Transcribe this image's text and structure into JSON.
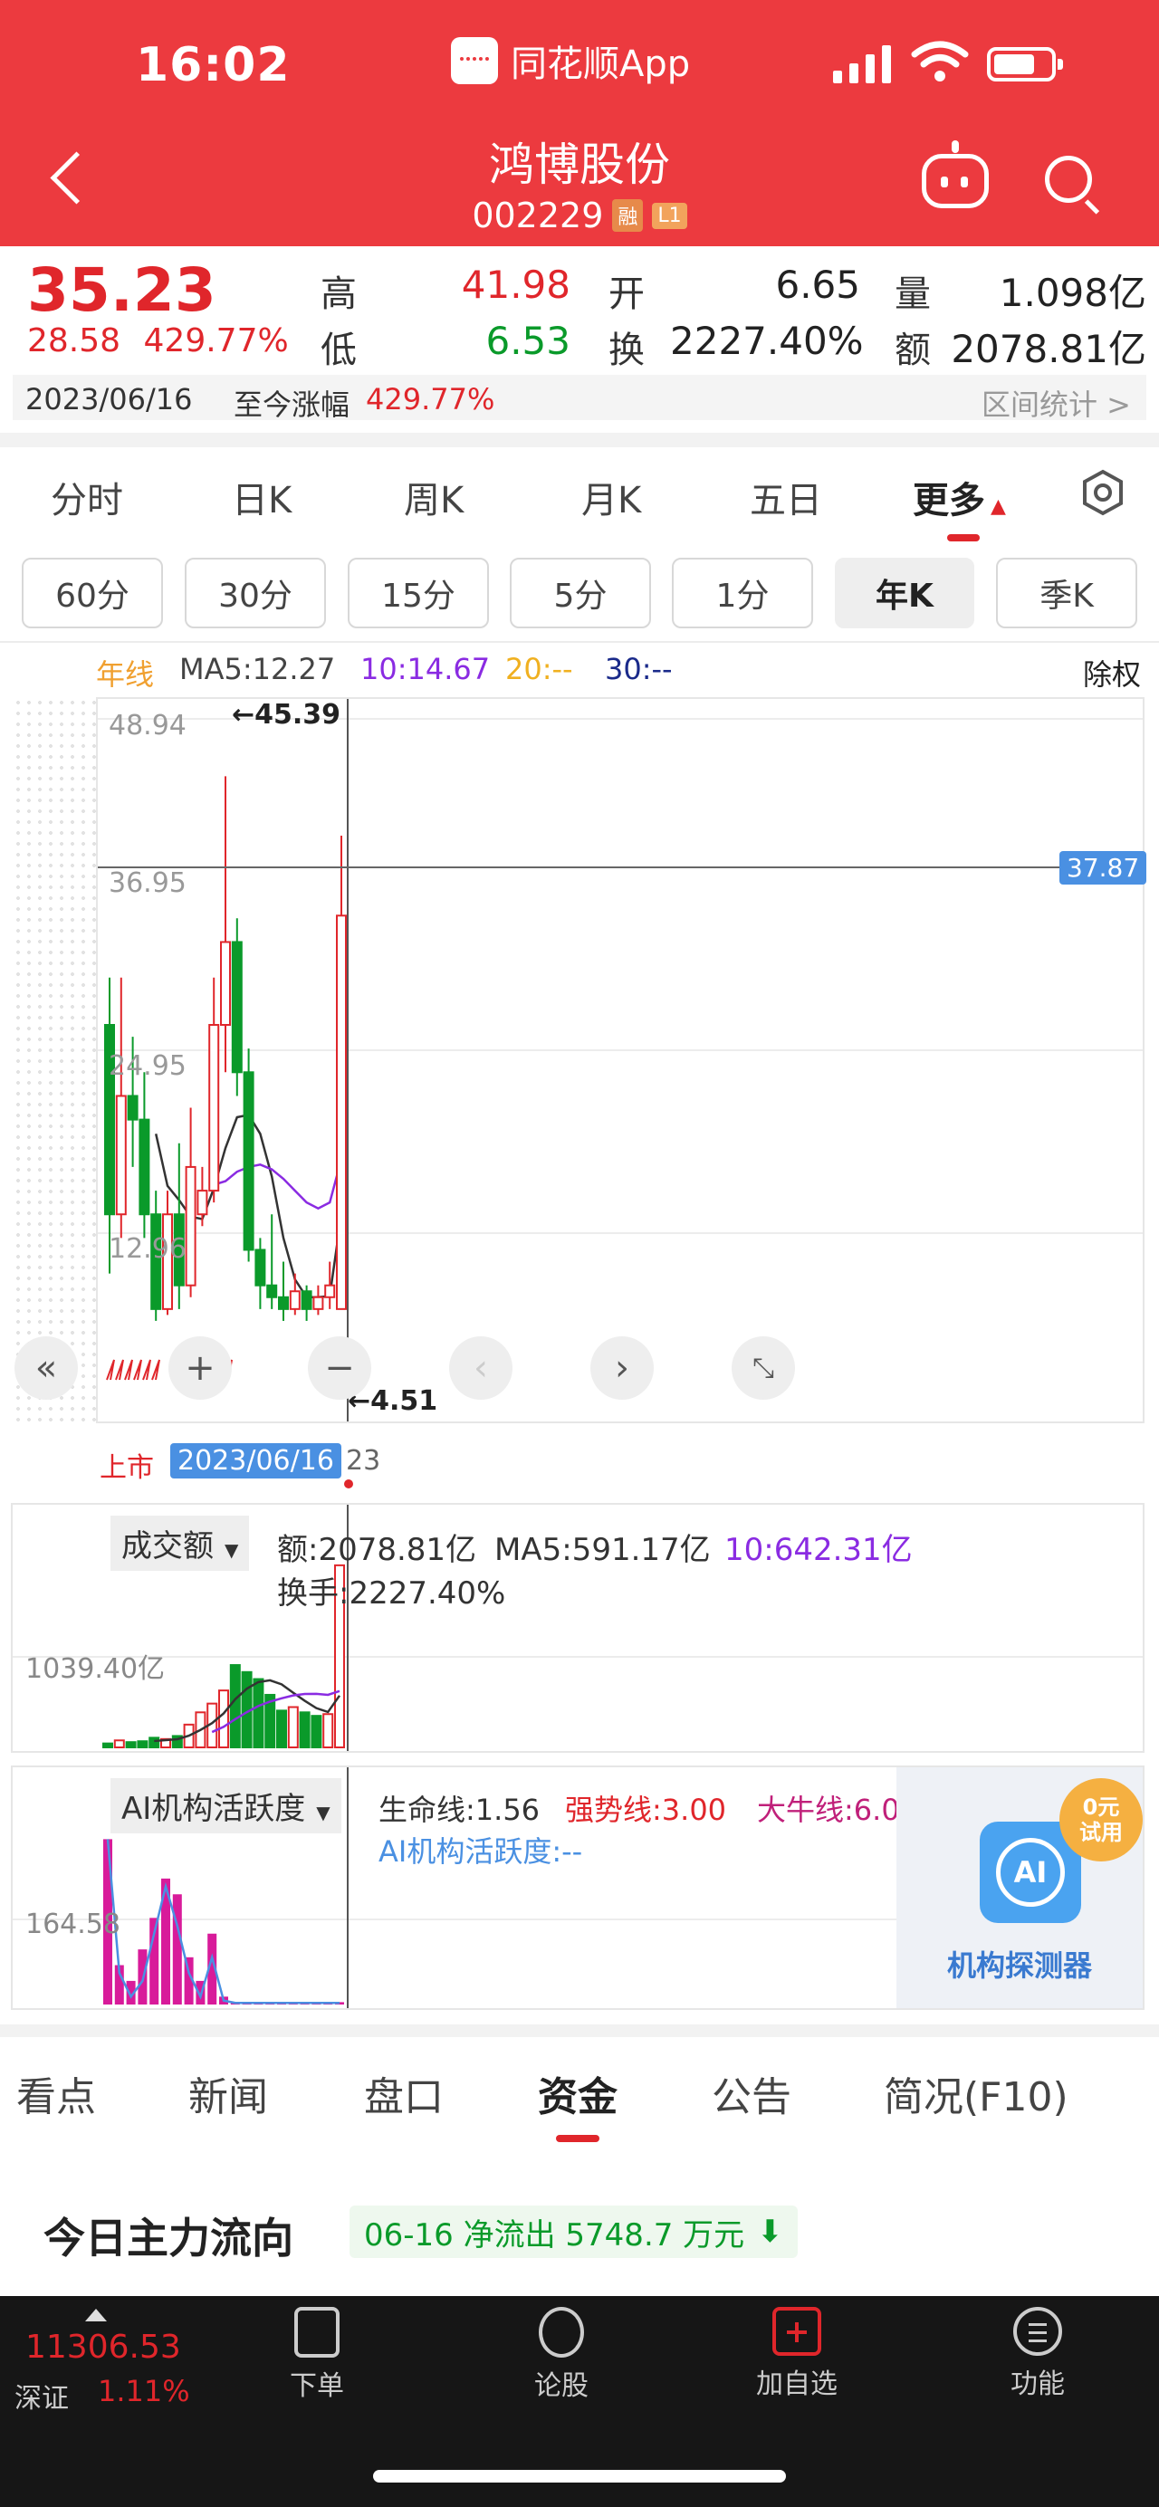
{
  "status_bar": {
    "time": "16:02",
    "app_name": "同花顺App"
  },
  "header": {
    "title": "鸿博股份",
    "code": "002229",
    "badge_rong": "融",
    "badge_level": "L1"
  },
  "quote": {
    "price": "35.23",
    "change": "28.58",
    "change_pct": "429.77%",
    "high_label": "高",
    "high": "41.98",
    "low_label": "低",
    "low": "6.53",
    "open_label": "开",
    "open": "6.65",
    "turnover_label": "换",
    "turnover": "2227.40%",
    "volume_label": "量",
    "volume": "1.098亿",
    "amount_label": "额",
    "amount": "2078.81亿",
    "date": "2023/06/16",
    "since_label": "至今涨幅",
    "since_pct": "429.77%",
    "interval_stats": "区间统计 >"
  },
  "period_tabs": [
    "分时",
    "日K",
    "周K",
    "月K",
    "五日",
    "更多"
  ],
  "sub_tabs": [
    "60分",
    "30分",
    "15分",
    "5分",
    "1分",
    "年K",
    "季K"
  ],
  "ma_line": {
    "name": "年线",
    "ma5": "MA5:12.27",
    "ma10": "10:14.67",
    "ma20": "20:--",
    "ma30": "30:--",
    "adjust": "除权"
  },
  "main_chart": {
    "y_labels": [
      "48.94",
      "36.95",
      "24.95",
      "12.96"
    ],
    "high_mark": "←45.39",
    "low_mark": "←4.51",
    "crosshair_value": "37.87",
    "list_label": "上市",
    "cursor_date": "2023/06/16",
    "cursor_date_suffix": "23"
  },
  "volume_panel": {
    "selector": "成交额",
    "amount": "额:2078.81亿",
    "ma5": "MA5:591.17亿",
    "ma10": "10:642.31亿",
    "turnover": "换手:2227.40%",
    "y_label": "1039.40亿"
  },
  "ai_panel": {
    "selector": "AI机构活跃度",
    "life_line": "生命线:1.56",
    "strong_line": "强势线:3.00",
    "bull_line": "大牛线:6.00",
    "activity": "AI机构活跃度:--",
    "y_label": "164.58",
    "promo_badge_1": "0元",
    "promo_badge_2": "试用",
    "promo_icon": "AI",
    "promo_title": "机构探测器"
  },
  "bottom_tabs": [
    "看点",
    "新闻",
    "盘口",
    "资金",
    "公告",
    "简况(F10)"
  ],
  "flow": {
    "title": "今日主力流向",
    "summary": "06-16 净流出 5748.7 万元"
  },
  "bottom_bar": {
    "index_value": "11306.53",
    "index_name": "深证",
    "index_pct": "1.11%",
    "items": [
      "下单",
      "论股",
      "加自选",
      "功能"
    ]
  },
  "colors": {
    "brand_red": "#ec3a3f",
    "up_red": "#e0262b",
    "down_green": "#0a9a2a",
    "accent_blue": "#4a90e2",
    "purple": "#8a2be2"
  },
  "chart_data": [
    {
      "type": "candlestick",
      "ylim": [
        0,
        52
      ],
      "bars": [
        {
          "o": 26.0,
          "c": 10.0,
          "h": 30.0,
          "l": 5.0
        },
        {
          "o": 10.0,
          "c": 20.0,
          "h": 30.0,
          "l": 8.0
        },
        {
          "o": 20.0,
          "c": 18.0,
          "h": 25.0,
          "l": 14.0
        },
        {
          "o": 18.0,
          "c": 10.0,
          "h": 22.0,
          "l": 8.0
        },
        {
          "o": 10.0,
          "c": 2.0,
          "h": 12.0,
          "l": 1.0
        },
        {
          "o": 2.0,
          "c": 10.0,
          "h": 12.0,
          "l": 1.5
        },
        {
          "o": 10.0,
          "c": 4.0,
          "h": 16.0,
          "l": 2.0
        },
        {
          "o": 4.0,
          "c": 14.0,
          "h": 19.0,
          "l": 3.0
        },
        {
          "o": 10.0,
          "c": 12.0,
          "h": 14.0,
          "l": 9.0
        },
        {
          "o": 12.0,
          "c": 26.0,
          "h": 30.0,
          "l": 11.0
        },
        {
          "o": 26.0,
          "c": 33.0,
          "h": 47.0,
          "l": 22.0
        },
        {
          "o": 33.0,
          "c": 22.0,
          "h": 35.0,
          "l": 20.0
        },
        {
          "o": 22.0,
          "c": 7.0,
          "h": 24.0,
          "l": 6.0
        },
        {
          "o": 7.0,
          "c": 4.0,
          "h": 8.0,
          "l": 2.0
        },
        {
          "o": 4.0,
          "c": 3.0,
          "h": 10.0,
          "l": 2.0
        },
        {
          "o": 3.0,
          "c": 2.0,
          "h": 6.0,
          "l": 1.0
        },
        {
          "o": 2.0,
          "c": 3.5,
          "h": 5.0,
          "l": 1.5
        },
        {
          "o": 3.5,
          "c": 2.0,
          "h": 4.0,
          "l": 1.0
        },
        {
          "o": 2.0,
          "c": 3.0,
          "h": 4.0,
          "l": 1.5
        },
        {
          "o": 3.0,
          "c": 4.0,
          "h": 6.0,
          "l": 2.0
        },
        {
          "o": 2.0,
          "c": 35.23,
          "h": 41.98,
          "l": 4.51
        }
      ],
      "ma5": [
        null,
        null,
        null,
        null,
        16.8,
        12.4,
        11.2,
        9.8,
        9.6,
        12.2,
        15.6,
        18.2,
        18.4,
        16.8,
        13.2,
        8.0,
        4.5,
        3.0,
        3.0,
        3.1,
        10.0
      ],
      "ma10": [
        null,
        null,
        null,
        null,
        null,
        null,
        null,
        null,
        null,
        12.5,
        12.8,
        13.6,
        14.0,
        14.2,
        13.8,
        13.0,
        12.0,
        11.0,
        10.5,
        11.0,
        14.67
      ]
    },
    {
      "type": "bar",
      "ylim": [
        0,
        2150
      ],
      "values": [
        45,
        80,
        60,
        70,
        110,
        95,
        130,
        260,
        400,
        500,
        650,
        940,
        860,
        780,
        600,
        420,
        460,
        400,
        360,
        380,
        2078.81
      ],
      "colors": [
        "green",
        "red",
        "green",
        "green",
        "green",
        "red",
        "green",
        "red",
        "red",
        "red",
        "red",
        "green",
        "green",
        "green",
        "green",
        "green",
        "red",
        "green",
        "green",
        "red",
        "red"
      ],
      "ma5": [
        null,
        null,
        null,
        null,
        73,
        83,
        93,
        133,
        199,
        277,
        388,
        550,
        670,
        746,
        766,
        720,
        624,
        532,
        448,
        404,
        591.17
      ],
      "ma10": [
        null,
        null,
        null,
        null,
        null,
        null,
        null,
        null,
        null,
        175,
        235,
        322,
        402,
        473,
        522,
        560,
        593,
        610,
        611,
        600,
        642.31
      ]
    },
    {
      "type": "bar",
      "ylim": [
        0,
        230
      ],
      "values": [
        210,
        50,
        30,
        70,
        110,
        160,
        140,
        60,
        30,
        90,
        10,
        3,
        3,
        3,
        3,
        3,
        3,
        3,
        3,
        3,
        3
      ],
      "line": [
        210,
        40,
        10,
        30,
        90,
        150,
        100,
        40,
        10,
        60,
        5,
        2,
        2,
        2,
        2,
        2,
        2,
        2,
        2,
        2,
        2
      ]
    }
  ]
}
